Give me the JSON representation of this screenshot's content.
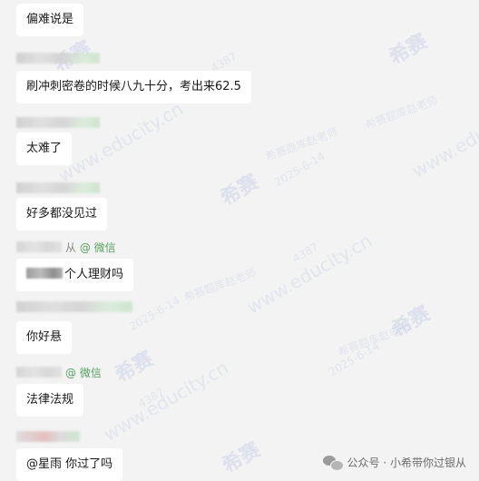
{
  "messages": [
    {
      "text": "偏难说是"
    },
    {
      "text": "刷冲刺密卷的时候八九十分，考出来62.5"
    },
    {
      "text": "太难了"
    },
    {
      "text": "好多都没见过"
    },
    {
      "source_prefix": "从",
      "source_icon": "@",
      "source_name": "微信",
      "text": "个人理财吗"
    },
    {
      "text": "你好悬"
    },
    {
      "source_icon": "@",
      "source_name": "微信",
      "text": "法律法规"
    },
    {
      "text": "@星雨 你过了吗"
    }
  ],
  "watermark": {
    "logo": "希赛",
    "url": "www.educity.cn",
    "date": "2025-6-14",
    "code": "4387",
    "teacher_tag": "希赛题库赵老师"
  },
  "footer": {
    "label": "公众号 · 小希带你过银从",
    "icon": "wechat-icon"
  },
  "colors": {
    "background": "#f3f3f3",
    "bubble": "#ffffff",
    "source_green": "#57a05e"
  }
}
